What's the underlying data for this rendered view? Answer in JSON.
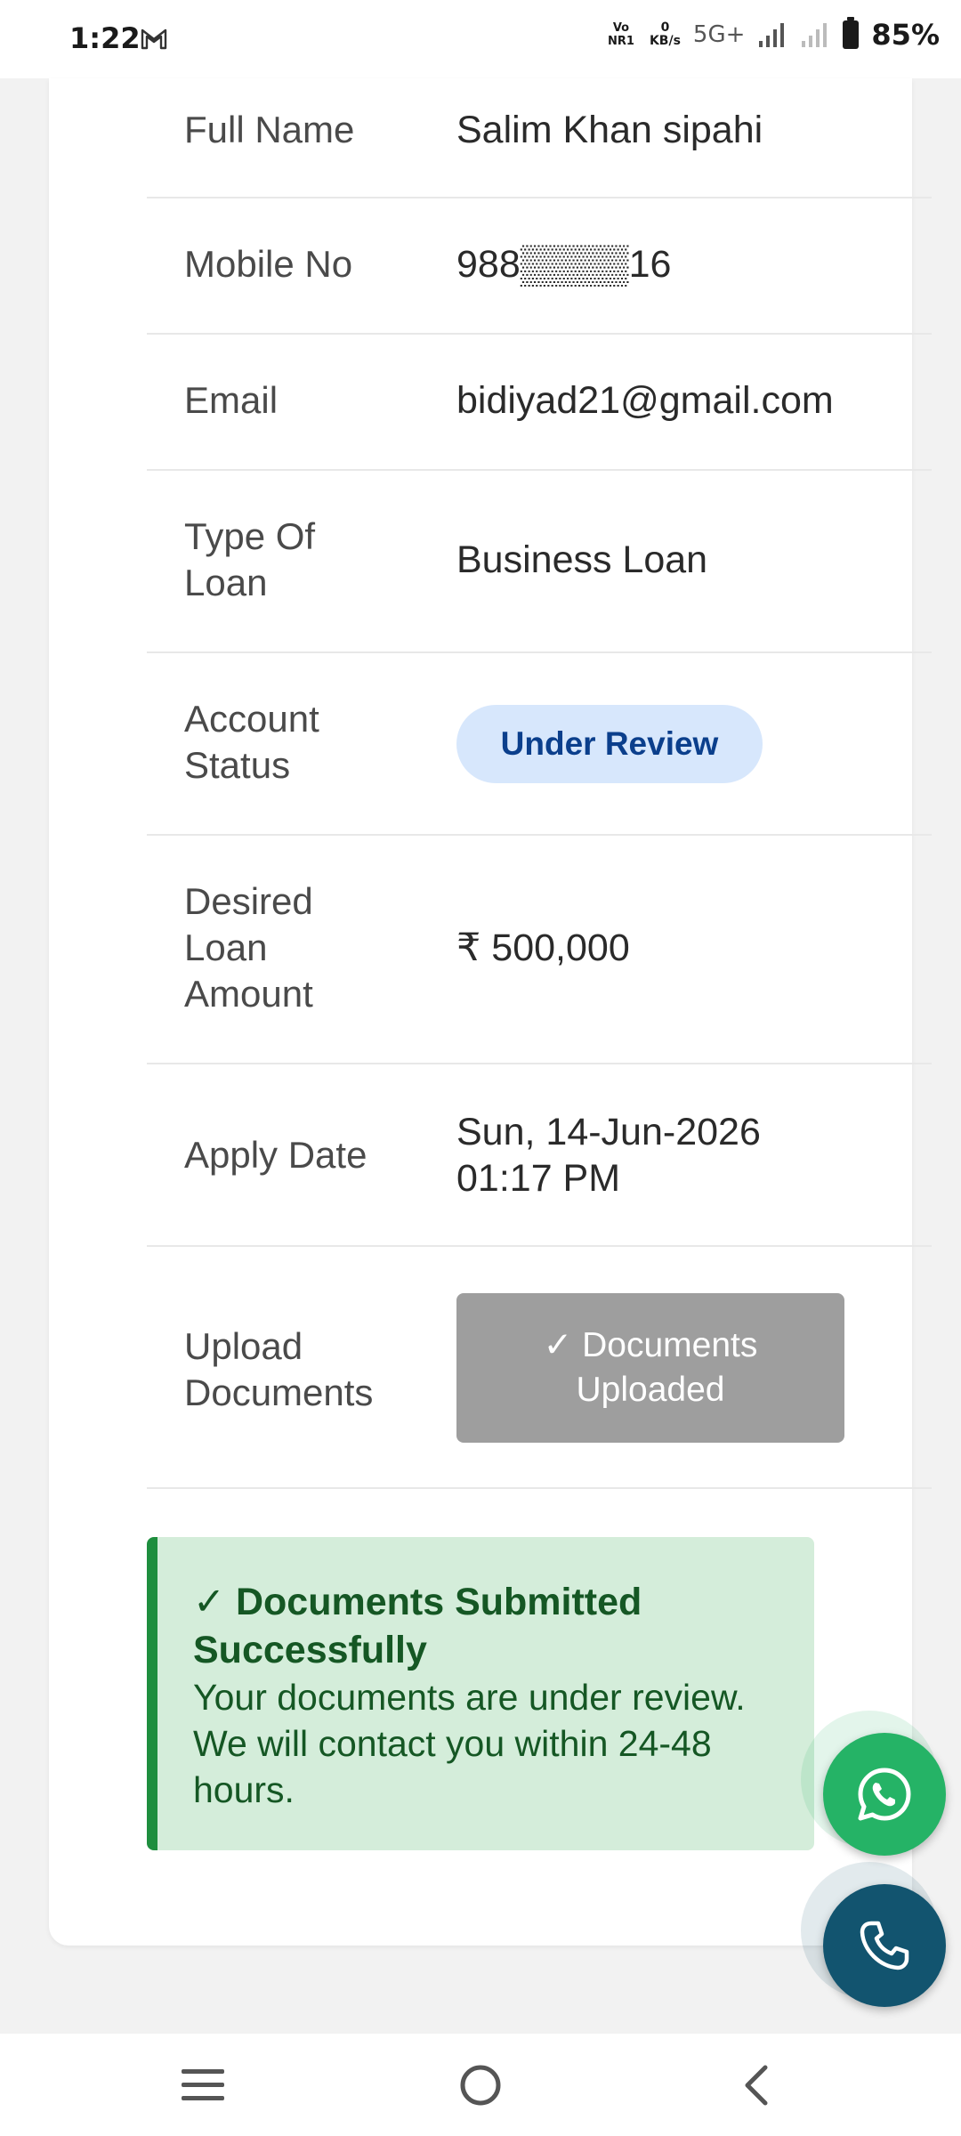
{
  "status_bar": {
    "time": "1:22",
    "volte": "Vo NR1",
    "data_rate_value": "0",
    "data_rate_unit": "KB/s",
    "network": "5G+",
    "battery": "85%"
  },
  "details": [
    {
      "label": "Full Name",
      "value": "Salim Khan sipahi"
    },
    {
      "label": "Mobile No",
      "value": "988▒▒▒▒16"
    },
    {
      "label": "Email",
      "value": "bidiyad21@gmail.com"
    },
    {
      "label": "Type Of Loan",
      "value": "Business Loan"
    },
    {
      "label": "Account Status",
      "value": "Under Review"
    },
    {
      "label": "Desired Loan Amount",
      "value": "₹ 500,000"
    },
    {
      "label": "Apply Date",
      "value_line1": "Sun, 14-Jun-2026",
      "value_line2": "01:17 PM"
    },
    {
      "label": "Upload Documents",
      "button_line1": "✓ Documents",
      "button_line2": "Uploaded"
    }
  ],
  "alert": {
    "title": "✓ Documents Submitted Successfully",
    "message": "Your documents are under review. We will contact you within 24-48 hours."
  },
  "colors": {
    "status_pill_bg": "#d7e7fc",
    "status_pill_text": "#0b3f8c",
    "uploaded_button": "#9e9e9e",
    "alert_bg": "#d4edda",
    "alert_border": "#1e8e3e",
    "whatsapp_green": "#25b366",
    "call_button": "#12546f"
  },
  "icons": {
    "whatsapp": "whatsapp-icon",
    "call": "phone-icon",
    "menu": "menu-icon",
    "home": "home-icon",
    "back": "back-icon"
  }
}
